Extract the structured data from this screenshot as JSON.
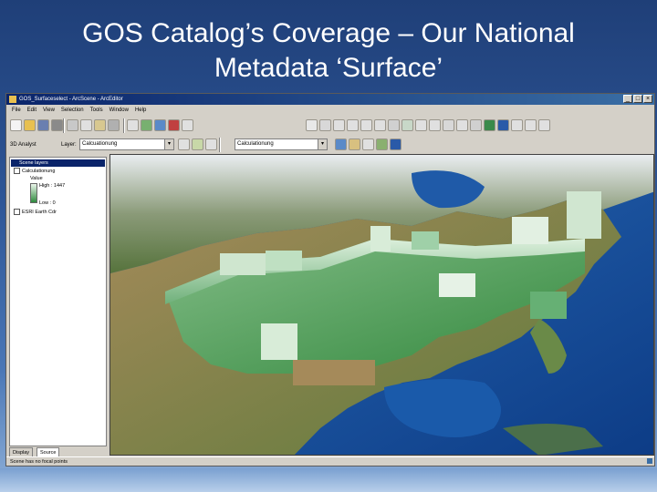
{
  "slide": {
    "title_line1": "GOS Catalog’s Coverage –  Our National",
    "title_line2": "Metadata ‘Surface’"
  },
  "window": {
    "title": "GOS_Surfaceselect - ArcScene - ArcEditor",
    "controls": [
      "_",
      "□",
      "×"
    ]
  },
  "menu": [
    "File",
    "Edit",
    "View",
    "Selection",
    "Tools",
    "Window",
    "Help"
  ],
  "toolbar2": {
    "layer_label": "3D Analyst",
    "layer_sub_label": "Layer:",
    "layer_value": "Calcuationung",
    "layer2_value": "Calculationung"
  },
  "toc": {
    "root": "Scene layers",
    "layer_name": "Calculationung",
    "value_label": "Value",
    "high_label": "High : 1447",
    "low_label": "Low : 0",
    "layer2_name": "ESRI Earth Cdr"
  },
  "tabs": [
    "Display",
    "Source"
  ],
  "status": "Scene has no focal points",
  "colors": {
    "slide_bg": "#2d5596",
    "title_text": "#ffffff",
    "surface_green": "#2f8a3e",
    "surface_high": "#d8ecd8"
  }
}
